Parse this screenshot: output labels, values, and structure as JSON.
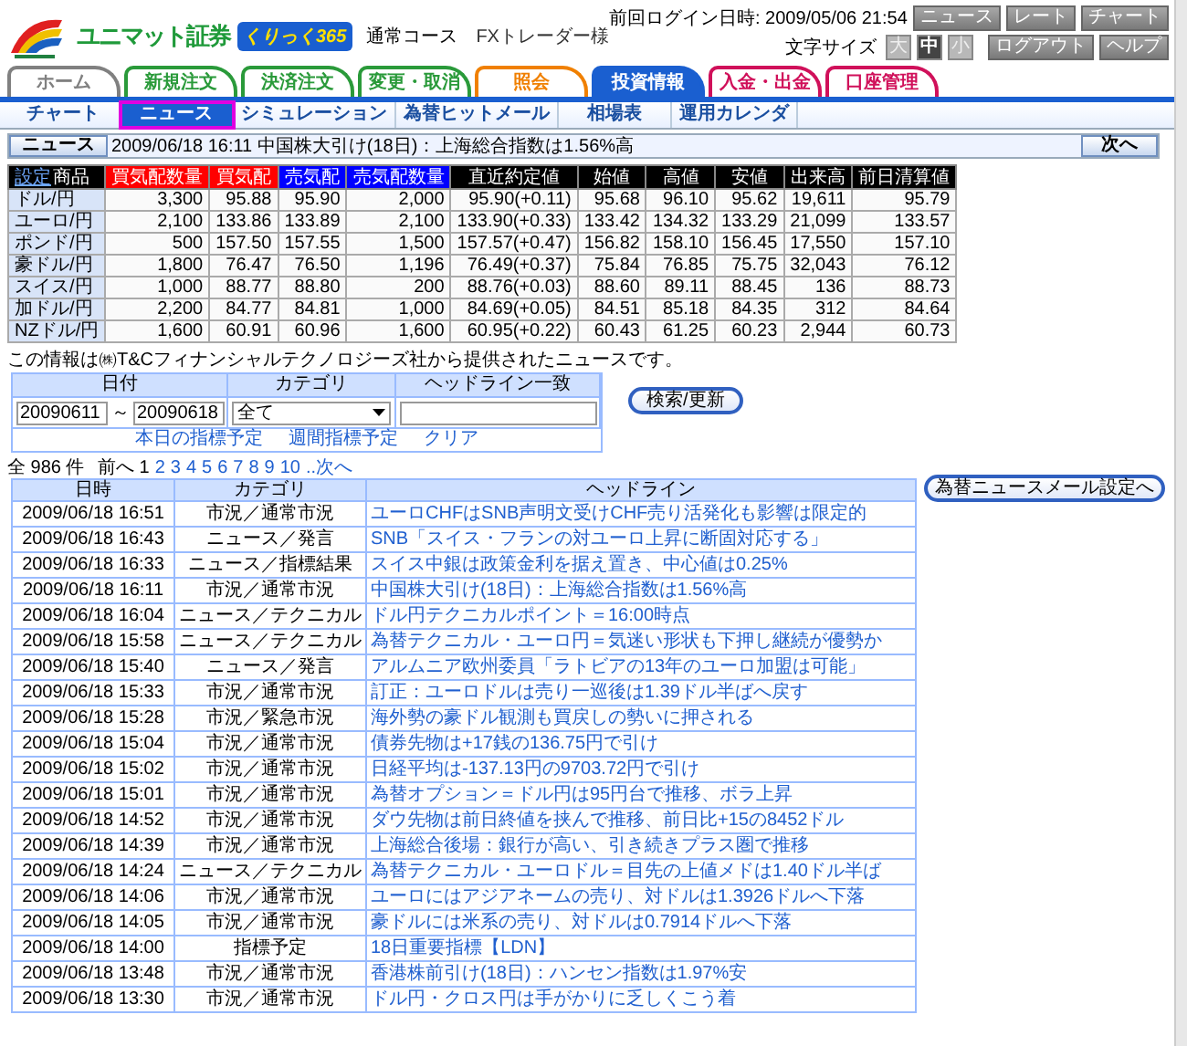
{
  "header": {
    "brand": "ユニマット証券",
    "badge": "くりっく365",
    "course": "通常コース",
    "user": "FXトレーダー様",
    "last_login": "前回ログイン日時: 2009/05/06 21:54",
    "top_buttons": [
      "ニュース",
      "レート",
      "チャート"
    ],
    "font_size_label": "文字サイズ",
    "font_sizes": [
      {
        "label": "大",
        "selected": false
      },
      {
        "label": "中",
        "selected": true
      },
      {
        "label": "小",
        "selected": false
      }
    ],
    "buttons": [
      "ログアウト",
      "ヘルプ"
    ]
  },
  "tabs": [
    {
      "label": "ホーム",
      "color": "#808080",
      "selected": false
    },
    {
      "label": "新規注文",
      "color": "#2a9a3a",
      "selected": false
    },
    {
      "label": "決済注文",
      "color": "#2a9a3a",
      "selected": false
    },
    {
      "label": "変更・取消",
      "color": "#2a9a3a",
      "selected": false
    },
    {
      "label": "照会",
      "color": "#f08000",
      "selected": false
    },
    {
      "label": "投資情報",
      "color": "#1a5fd0",
      "selected": true
    },
    {
      "label": "入金・出金",
      "color": "#d0105a",
      "selected": false
    },
    {
      "label": "口座管理",
      "color": "#d0105a",
      "selected": false
    }
  ],
  "subtabs": [
    {
      "label": "チャート",
      "selected": false
    },
    {
      "label": "ニュース",
      "selected": true
    },
    {
      "label": "シミュレーション",
      "selected": false
    },
    {
      "label": "為替ヒットメール",
      "selected": false
    },
    {
      "label": "相場表",
      "selected": false
    },
    {
      "label": "運用カレンダ",
      "selected": false
    }
  ],
  "ticker": {
    "label": "ニュース",
    "text": "2009/06/18 16:11  中国株大引け(18日)：上海総合指数は1.56%高",
    "next": "次へ"
  },
  "quotes": {
    "settings_link": "設定",
    "columns": [
      {
        "label": "商品",
        "color": "#000000"
      },
      {
        "label": "買気配数量",
        "color": "#ff0000"
      },
      {
        "label": "買気配",
        "color": "#ff0000"
      },
      {
        "label": "売気配",
        "color": "#0000ff"
      },
      {
        "label": "売気配数量",
        "color": "#0000ff"
      },
      {
        "label": "直近約定値",
        "color": "#000000"
      },
      {
        "label": "始値",
        "color": "#000000"
      },
      {
        "label": "高値",
        "color": "#000000"
      },
      {
        "label": "安値",
        "color": "#000000"
      },
      {
        "label": "出来高",
        "color": "#000000"
      },
      {
        "label": "前日清算値",
        "color": "#000000"
      }
    ],
    "rows": [
      {
        "cells": [
          "ドル/円",
          "3,300",
          "95.88",
          "95.90",
          "2,000",
          "95.90(+0.11)",
          "95.68",
          "96.10",
          "95.62",
          "19,611",
          "95.79"
        ]
      },
      {
        "cells": [
          "ユーロ/円",
          "2,100",
          "133.86",
          "133.89",
          "2,100",
          "133.90(+0.33)",
          "133.42",
          "134.32",
          "133.29",
          "21,099",
          "133.57"
        ]
      },
      {
        "cells": [
          "ポンド/円",
          "500",
          "157.50",
          "157.55",
          "1,500",
          "157.57(+0.47)",
          "156.82",
          "158.10",
          "156.45",
          "17,550",
          "157.10"
        ]
      },
      {
        "cells": [
          "豪ドル/円",
          "1,800",
          "76.47",
          "76.50",
          "1,196",
          "76.49(+0.37)",
          "75.84",
          "76.85",
          "75.75",
          "32,043",
          "76.12"
        ]
      },
      {
        "cells": [
          "スイス/円",
          "1,000",
          "88.77",
          "88.80",
          "200",
          "88.76(+0.03)",
          "88.60",
          "89.11",
          "88.45",
          "136",
          "88.73"
        ]
      },
      {
        "cells": [
          "加ドル/円",
          "2,200",
          "84.77",
          "84.81",
          "1,000",
          "84.69(+0.05)",
          "84.51",
          "85.18",
          "84.35",
          "312",
          "84.64"
        ]
      },
      {
        "cells": [
          "NZドル/円",
          "1,600",
          "60.91",
          "60.96",
          "1,600",
          "60.95(+0.22)",
          "60.43",
          "61.25",
          "60.23",
          "2,944",
          "60.73"
        ]
      }
    ]
  },
  "search": {
    "note": "この情報は㈱T&Cフィナンシャルテクノロジーズ社から提供されたニュースです。",
    "headers": [
      "日付",
      "カテゴリ",
      "ヘッドライン一致"
    ],
    "date_from": "20090611",
    "tilde": "～",
    "date_to": "20090618",
    "category": "全て",
    "links": [
      "本日の指標予定",
      "週間指標予定",
      "クリア"
    ],
    "button": "検索/更新"
  },
  "pager": {
    "total": "全 986 件",
    "prev": "前へ",
    "pages": [
      {
        "label": "1",
        "selected": true
      },
      {
        "label": "2",
        "selected": false
      },
      {
        "label": "3",
        "selected": false
      },
      {
        "label": "4",
        "selected": false
      },
      {
        "label": "5",
        "selected": false
      },
      {
        "label": "6",
        "selected": false
      },
      {
        "label": "7",
        "selected": false
      },
      {
        "label": "8",
        "selected": false
      },
      {
        "label": "9",
        "selected": false
      },
      {
        "label": "10",
        "selected": false
      }
    ],
    "next": "..次へ"
  },
  "news": {
    "mail_button": "為替ニュースメール設定へ",
    "columns": [
      "日時",
      "カテゴリ",
      "ヘッドライン"
    ],
    "rows": [
      [
        "2009/06/18 16:51",
        "市況／通常市況",
        "ユーロCHFはSNB声明文受けCHF売り活発化も影響は限定的"
      ],
      [
        "2009/06/18 16:43",
        "ニュース／発言",
        "SNB「スイス・フランの対ユーロ上昇に断固対応する」"
      ],
      [
        "2009/06/18 16:33",
        "ニュース／指標結果",
        "スイス中銀は政策金利を据え置き、中心値は0.25%"
      ],
      [
        "2009/06/18 16:11",
        "市況／通常市況",
        "中国株大引け(18日)：上海総合指数は1.56%高"
      ],
      [
        "2009/06/18 16:04",
        "ニュース／テクニカル",
        "ドル円テクニカルポイント＝16:00時点"
      ],
      [
        "2009/06/18 15:58",
        "ニュース／テクニカル",
        "為替テクニカル・ユーロ円＝気迷い形状も下押し継続が優勢か"
      ],
      [
        "2009/06/18 15:40",
        "ニュース／発言",
        "アルムニア欧州委員「ラトビアの13年のユーロ加盟は可能」"
      ],
      [
        "2009/06/18 15:33",
        "市況／通常市況",
        "訂正：ユーロドルは売り一巡後は1.39ドル半ばへ戻す"
      ],
      [
        "2009/06/18 15:28",
        "市況／緊急市況",
        "海外勢の豪ドル観測も買戻しの勢いに押される"
      ],
      [
        "2009/06/18 15:04",
        "市況／通常市況",
        "債券先物は+17銭の136.75円で引け"
      ],
      [
        "2009/06/18 15:02",
        "市況／通常市況",
        "日経平均は-137.13円の9703.72円で引け"
      ],
      [
        "2009/06/18 15:01",
        "市況／通常市況",
        "為替オプション＝ドル円は95円台で推移、ボラ上昇"
      ],
      [
        "2009/06/18 14:52",
        "市況／通常市況",
        "ダウ先物は前日終値を挟んで推移、前日比+15の8452ドル"
      ],
      [
        "2009/06/18 14:39",
        "市況／通常市況",
        "上海総合後場：銀行が高い、引き続きプラス圏で推移"
      ],
      [
        "2009/06/18 14:24",
        "ニュース／テクニカル",
        "為替テクニカル・ユーロドル＝目先の上値メドは1.40ドル半ば"
      ],
      [
        "2009/06/18 14:06",
        "市況／通常市況",
        "ユーロにはアジアネームの売り、対ドルは1.3926ドルへ下落"
      ],
      [
        "2009/06/18 14:05",
        "市況／通常市況",
        "豪ドルには米系の売り、対ドルは0.7914ドルへ下落"
      ],
      [
        "2009/06/18 14:00",
        "指標予定",
        "18日重要指標【LDN】"
      ],
      [
        "2009/06/18 13:48",
        "市況／通常市況",
        "香港株前引け(18日)：ハンセン指数は1.97%安"
      ],
      [
        "2009/06/18 13:30",
        "市況／通常市況",
        "ドル円・クロス円は手がかりに乏しくこう着"
      ]
    ]
  }
}
